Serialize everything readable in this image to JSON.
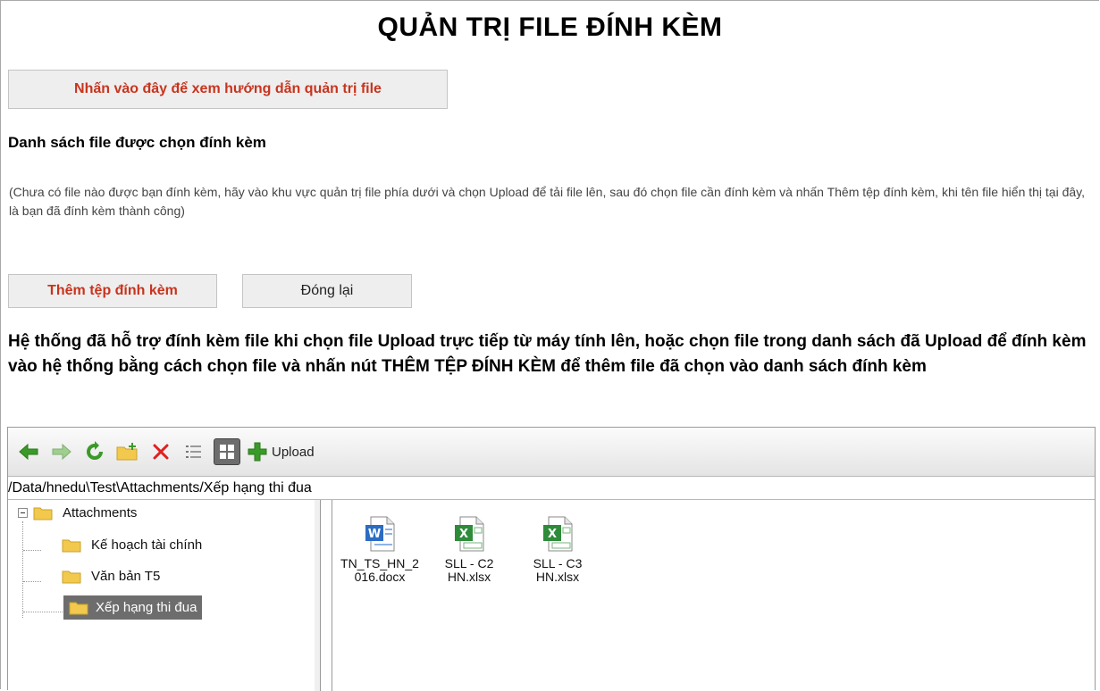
{
  "title": "QUẢN TRỊ FILE ĐÍNH KÈM",
  "guide_button": "Nhấn vào đây để xem hướng dẫn quản trị file",
  "attachment_list_title": "Danh sách file được chọn đính kèm",
  "empty_note": "(Chưa có file nào được bạn đính kèm, hãy vào khu vực quản trị file phía dưới và chọn Upload để tải file lên, sau đó chọn file cần đính kèm và nhấn Thêm tệp đính kèm, khi tên file hiển thị tại đây, là bạn đã đính kèm thành công)",
  "add_attachment_button": "Thêm tệp đính kèm",
  "close_button": "Đóng lại",
  "support_text": "Hệ thống đã hỗ trợ đính kèm file khi chọn file Upload trực tiếp từ máy tính lên, hoặc chọn file trong danh sách đã Upload để đính kèm vào hệ thống bằng cách chọn file và nhấn nút THÊM TỆP ĐÍNH KÈM để thêm file đã chọn vào danh sách đính kèm",
  "file_manager": {
    "toolbar": {
      "icons": [
        "back-icon",
        "forward-icon",
        "refresh-icon",
        "new-folder-icon",
        "delete-icon",
        "list-view-icon",
        "thumbnail-view-icon",
        "upload-icon"
      ],
      "upload_label": "Upload"
    },
    "path": "/Data/hnedu\\Test\\Attachments/Xếp hạng thi đua",
    "tree": {
      "root": "Attachments",
      "children": [
        "Kế hoạch tài chính",
        "Văn bản T5",
        "Xếp hạng thi đua"
      ],
      "selected": "Xếp hạng thi đua"
    },
    "files": [
      {
        "name": "TN_TS_HN_2016.docx",
        "line1": "TN_TS_HN_2",
        "line2": "016.docx",
        "type": "word"
      },
      {
        "name": "SLL - C2 HN.xlsx",
        "line1": "SLL - C2",
        "line2": "HN.xlsx",
        "type": "excel"
      },
      {
        "name": "SLL - C3 HN.xlsx",
        "line1": "SLL - C3",
        "line2": "HN.xlsx",
        "type": "excel"
      }
    ]
  },
  "colors": {
    "accent_red": "#c8341e",
    "selection_gray": "#6d6d6d",
    "folder_yellow": "#f2c94c"
  }
}
